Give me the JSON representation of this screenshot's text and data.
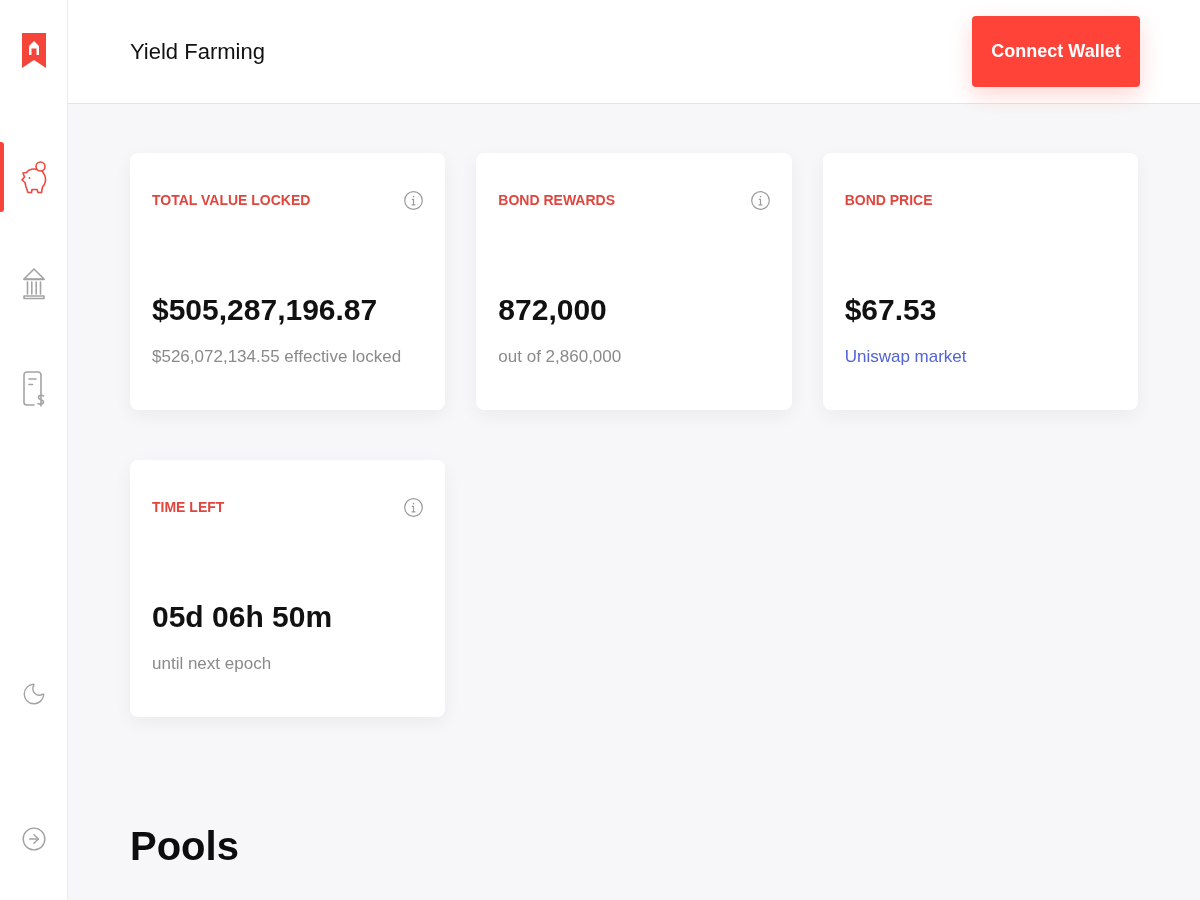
{
  "sidebar": {
    "items": [
      {
        "selected": true
      },
      {
        "selected": false
      },
      {
        "selected": false
      }
    ]
  },
  "header": {
    "title": "Yield Farming",
    "button": "Connect Wallet"
  },
  "cards": [
    {
      "label": "TOTAL VALUE LOCKED",
      "info": true,
      "value": "$505,287,196.87",
      "note": {
        "kind": "text",
        "text": "$526,072,134.55 effective locked"
      }
    },
    {
      "label": "BOND REWARDS",
      "info": true,
      "value": "872,000",
      "note": {
        "kind": "text",
        "text": "out of 2,860,000"
      }
    },
    {
      "label": "BOND PRICE",
      "info": false,
      "value": "$67.53",
      "note": {
        "kind": "link",
        "text": "Uniswap market"
      }
    },
    {
      "label": "TIME LEFT",
      "info": true,
      "value": "05d 06h 50m",
      "note": {
        "kind": "text",
        "text": "until next epoch"
      }
    }
  ],
  "pools": {
    "title": "Pools"
  }
}
